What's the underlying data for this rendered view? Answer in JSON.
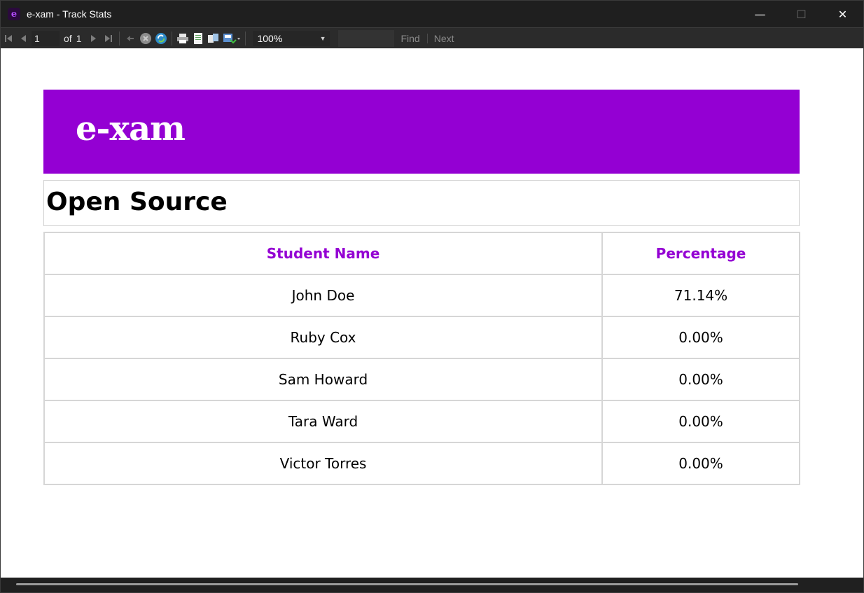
{
  "window": {
    "title": "e-xam - Track Stats",
    "icon": "e",
    "controls": {
      "minimize": "—",
      "maximize": "☐",
      "close": "✕"
    }
  },
  "toolbar": {
    "page_current": "1",
    "of_label": "of",
    "page_total": "1",
    "zoom": "100%",
    "find_label": "Find",
    "next_label": "Next",
    "icons": [
      "first-page-icon",
      "previous-page-icon",
      "next-page-icon",
      "last-page-icon",
      "back-icon",
      "stop-icon",
      "refresh-icon",
      "print-icon",
      "print-layout-icon",
      "page-setup-icon",
      "export-icon"
    ]
  },
  "report": {
    "brand": "e-xam",
    "title": "Open Source",
    "columns": [
      "Student Name",
      "Percentage"
    ],
    "rows": [
      {
        "name": "John Doe",
        "percentage": "71.14%"
      },
      {
        "name": "Ruby Cox",
        "percentage": "0.00%"
      },
      {
        "name": "Sam Howard",
        "percentage": "0.00%"
      },
      {
        "name": "Tara Ward",
        "percentage": "0.00%"
      },
      {
        "name": "Victor Torres",
        "percentage": "0.00%"
      }
    ],
    "colors": {
      "brand": "#9400d3"
    }
  }
}
